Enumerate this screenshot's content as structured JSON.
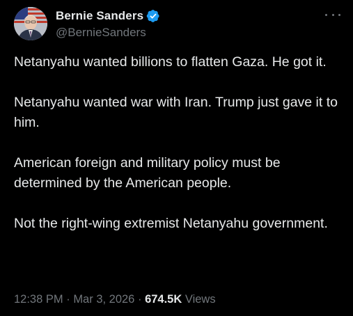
{
  "author": {
    "display_name": "Bernie Sanders",
    "handle": "@BernieSanders",
    "verified": true,
    "verified_color": "#1d9bf0"
  },
  "more_icon": "more-horizontal-icon",
  "tweet": {
    "paragraphs": [
      "Netanyahu wanted billions to flatten Gaza. He got it.",
      "Netanyahu wanted war with Iran. Trump just gave it to him.",
      "American foreign and military policy must be determined by the American people.",
      "Not the right-wing extremist Netanyahu government."
    ]
  },
  "meta": {
    "time": "12:38 PM",
    "separator": "·",
    "date": "Mar 3, 2026",
    "views_count": "674.5K",
    "views_label": "Views"
  }
}
